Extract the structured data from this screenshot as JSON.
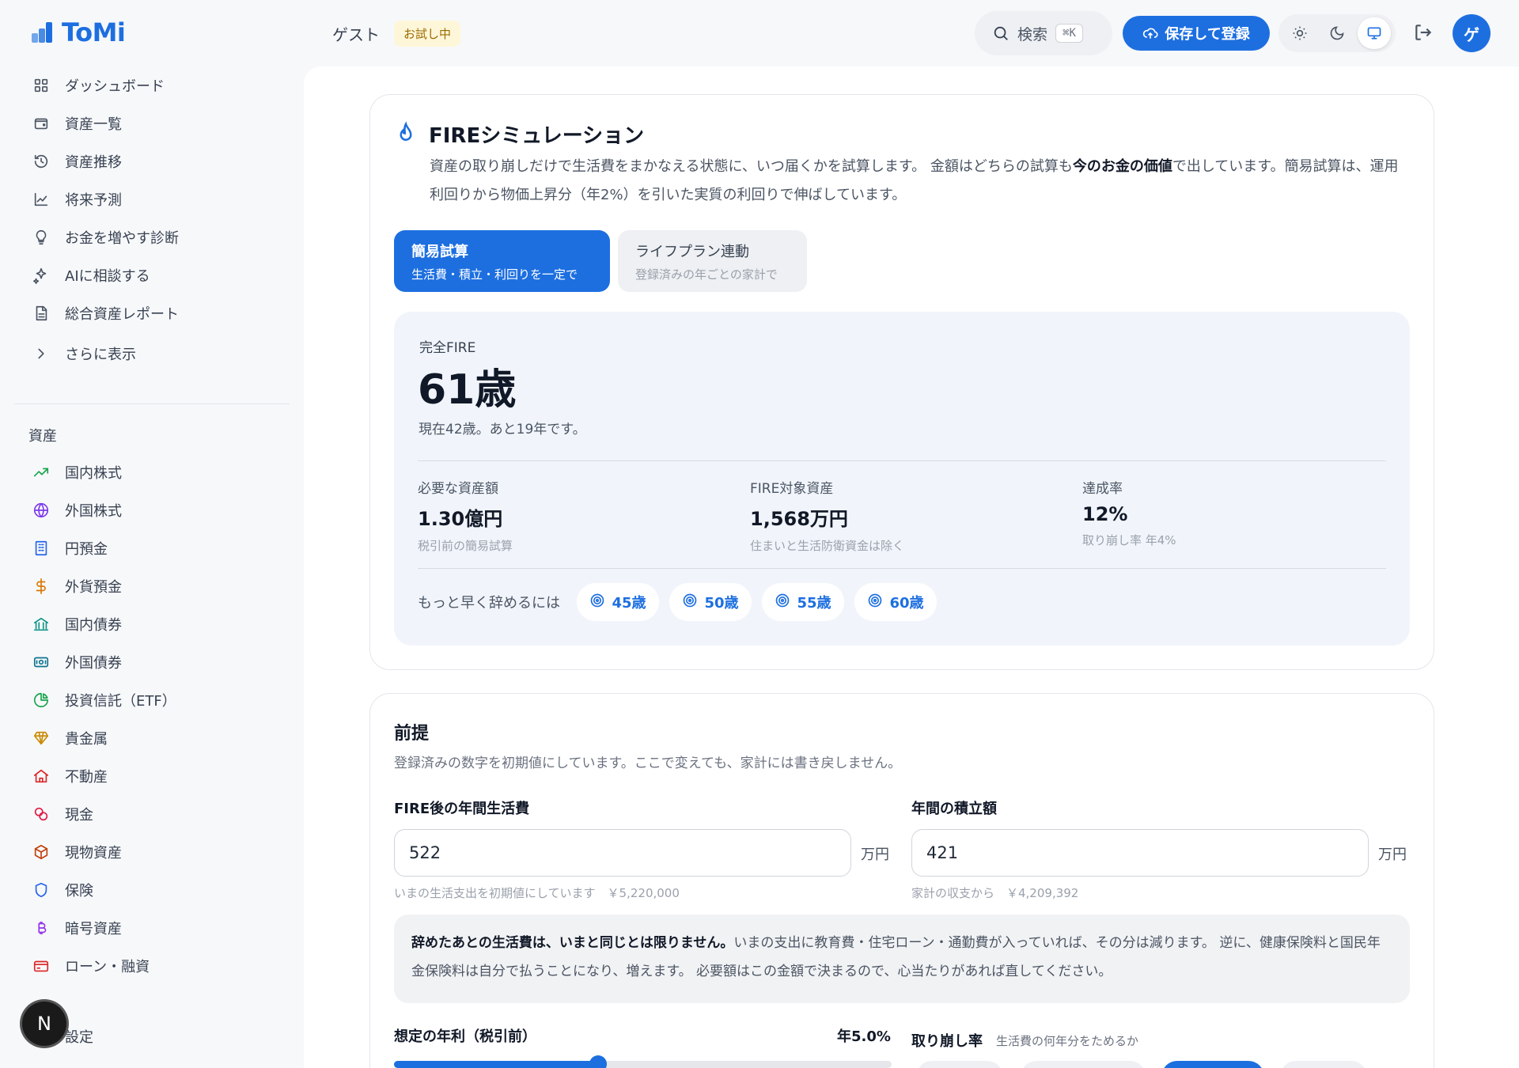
{
  "app": {
    "name": "ToMi"
  },
  "header": {
    "guest_label": "ゲスト",
    "trial_badge": "お試し中",
    "search_label": "検索",
    "search_shortcut": "⌘K",
    "save_button": "保存して登録",
    "avatar_initial": "ゲ"
  },
  "sidebar": {
    "main_items": [
      {
        "label": "ダッシュボード",
        "icon": "grid-icon"
      },
      {
        "label": "資産一覧",
        "icon": "wallet-icon"
      },
      {
        "label": "資産推移",
        "icon": "history-icon"
      },
      {
        "label": "将来予測",
        "icon": "line-chart-icon"
      },
      {
        "label": "お金を増やす診断",
        "icon": "lightbulb-icon"
      },
      {
        "label": "AIに相談する",
        "icon": "sparkle-icon"
      },
      {
        "label": "総合資産レポート",
        "icon": "document-icon"
      },
      {
        "label": "さらに表示",
        "icon": "chevron-right-icon"
      }
    ],
    "section_label": "資産",
    "asset_items": [
      {
        "label": "国内株式",
        "icon": "trending-up-icon",
        "color": "#16a34a"
      },
      {
        "label": "外国株式",
        "icon": "globe-icon",
        "color": "#7c3aed"
      },
      {
        "label": "円預金",
        "icon": "building-icon",
        "color": "#2563eb"
      },
      {
        "label": "外貨預金",
        "icon": "dollar-icon",
        "color": "#d97706"
      },
      {
        "label": "国内債券",
        "icon": "bank-icon",
        "color": "#0d9488"
      },
      {
        "label": "外国債券",
        "icon": "banknote-icon",
        "color": "#0e7490"
      },
      {
        "label": "投資信託（ETF）",
        "icon": "pie-chart-icon",
        "color": "#16a34a"
      },
      {
        "label": "貴金属",
        "icon": "gem-icon",
        "color": "#ca8a04"
      },
      {
        "label": "不動産",
        "icon": "home-icon",
        "color": "#dc2626"
      },
      {
        "label": "現金",
        "icon": "coins-icon",
        "color": "#e11d48"
      },
      {
        "label": "現物資産",
        "icon": "package-icon",
        "color": "#c2410c"
      },
      {
        "label": "保険",
        "icon": "shield-icon",
        "color": "#2563eb"
      },
      {
        "label": "暗号資産",
        "icon": "bitcoin-icon",
        "color": "#9333ea"
      },
      {
        "label": "ローン・融資",
        "icon": "credit-card-icon",
        "color": "#dc2626"
      }
    ],
    "settings_label": "設定",
    "n_badge": "N"
  },
  "fire": {
    "title": "FIREシミュレーション",
    "desc_1": "資産の取り崩しだけで生活費をまかなえる状態に、いつ届くかを試算します。 金額はどちらの試算も",
    "desc_bold": "今のお金の価値",
    "desc_2": "で出しています。簡易試算は、運用利回りから物価上昇分（年2%）を引いた実質の利回りで伸ばしています。",
    "tabs": [
      {
        "title": "簡易試算",
        "sub": "生活費・積立・利回りを一定で"
      },
      {
        "title": "ライフプラン連動",
        "sub": "登録済みの年ごとの家計で"
      }
    ],
    "result": {
      "label": "完全FIRE",
      "age": "61歳",
      "note": "現在42歳。あと19年です。",
      "stats": [
        {
          "label": "必要な資産額",
          "value": "1.30億円",
          "sub": "税引前の簡易試算"
        },
        {
          "label": "FIRE対象資産",
          "value": "1,568万円",
          "sub": "住まいと生活防衛資金は除く"
        },
        {
          "label": "達成率",
          "value": "12%",
          "sub": "取り崩し率 年4%"
        }
      ],
      "early_label": "もっと早く辞めるには",
      "early_chips": [
        "45歳",
        "50歳",
        "55歳",
        "60歳"
      ]
    }
  },
  "assumptions": {
    "title": "前提",
    "desc": "登録済みの数字を初期値にしています。ここで変えても、家計には書き戻しません。",
    "living_cost": {
      "label": "FIRE後の年間生活費",
      "value": "522",
      "unit": "万円",
      "hint": "いまの生活支出を初期値にしています　￥5,220,000"
    },
    "savings": {
      "label": "年間の積立額",
      "value": "421",
      "unit": "万円",
      "hint": "家計の収支から　￥4,209,392"
    },
    "note_bold": "辞めたあとの生活費は、いまと同じとは限りません。",
    "note_rest": "いまの支出に教育費・住宅ローン・通勤費が入っていれば、その分は減ります。 逆に、健康保険料と国民年金保険料は自分で払うことになり、増えます。 必要額はこの金額で決まるので、心当たりがあれば直してください。",
    "rate_label": "想定の年利（税引前）",
    "rate_value": "年5.0%",
    "rate_slider_fraction": 0.41,
    "withdraw_label": "取り崩し率",
    "withdraw_sub": "生活費の何年分をためるか"
  },
  "colors": {
    "accent": "#1d6fe0"
  }
}
